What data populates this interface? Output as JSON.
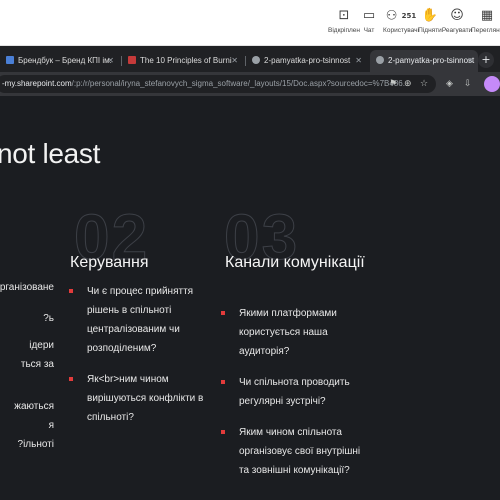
{
  "meeting_toolbar": {
    "items": [
      {
        "label": "Відкріплен",
        "icon": "unpin-icon",
        "glyph": "⊡"
      },
      {
        "label": "Чат",
        "icon": "chat-icon",
        "glyph": "▭"
      },
      {
        "label": "Користувачі",
        "icon": "people-icon",
        "glyph": "⚇",
        "count": "251"
      },
      {
        "label": "Підняти",
        "icon": "raise-hand-icon",
        "glyph": "✋"
      },
      {
        "label": "Реагувати",
        "icon": "react-icon",
        "glyph": "☺"
      },
      {
        "label": "Перегляну",
        "icon": "view-icon",
        "glyph": "▦"
      }
    ]
  },
  "tabs": [
    {
      "title": "Брендбук – Бренд КПІ ім.",
      "favicon_color": "#4a7fd6",
      "active": false
    },
    {
      "title": "The 10 Principles of Burni",
      "favicon_color": "#c53a3a",
      "active": false
    },
    {
      "title": "2-pamyatka-pro-tsinnost",
      "favicon_color": "#9aa0a6",
      "active": false
    },
    {
      "title": "2-pamyatka-pro-tsinnost",
      "favicon_color": "#9aa0a6",
      "active": true
    }
  ],
  "address": {
    "host": "-my.sharepoint.com",
    "path": "/:p:/r/personal/iryna_stefanovych_sigma_software/_layouts/15/Doc.aspx?sourcedoc=%7B486..."
  },
  "document": {
    "heading": "t not least",
    "numbers": [
      "02",
      "03"
    ],
    "left_clipped_lines": [
      "рганізоване",
      "ь?",
      "ідери",
      "ться за",
      "",
      "жаються",
      "я",
      "ільноті?"
    ],
    "columns": [
      {
        "title": "Керування",
        "items": [
          "Чи є процес прийняття рішень в спільноті централізованим чи розподіленим?",
          "Як<br>ним чином вирішуються конфлікти в спільноті?"
        ]
      },
      {
        "title": "Канали комунікації",
        "items": [
          "Якими платформами користується наша аудиторія?",
          "Чи спільнота проводить регулярні зустрічі?",
          "Яким чином спільнота організовує свої внутрішні та зовнішні комунікації?"
        ]
      }
    ]
  },
  "colors": {
    "accent_bullet": "#e23b3b",
    "background": "#1b1d21"
  }
}
